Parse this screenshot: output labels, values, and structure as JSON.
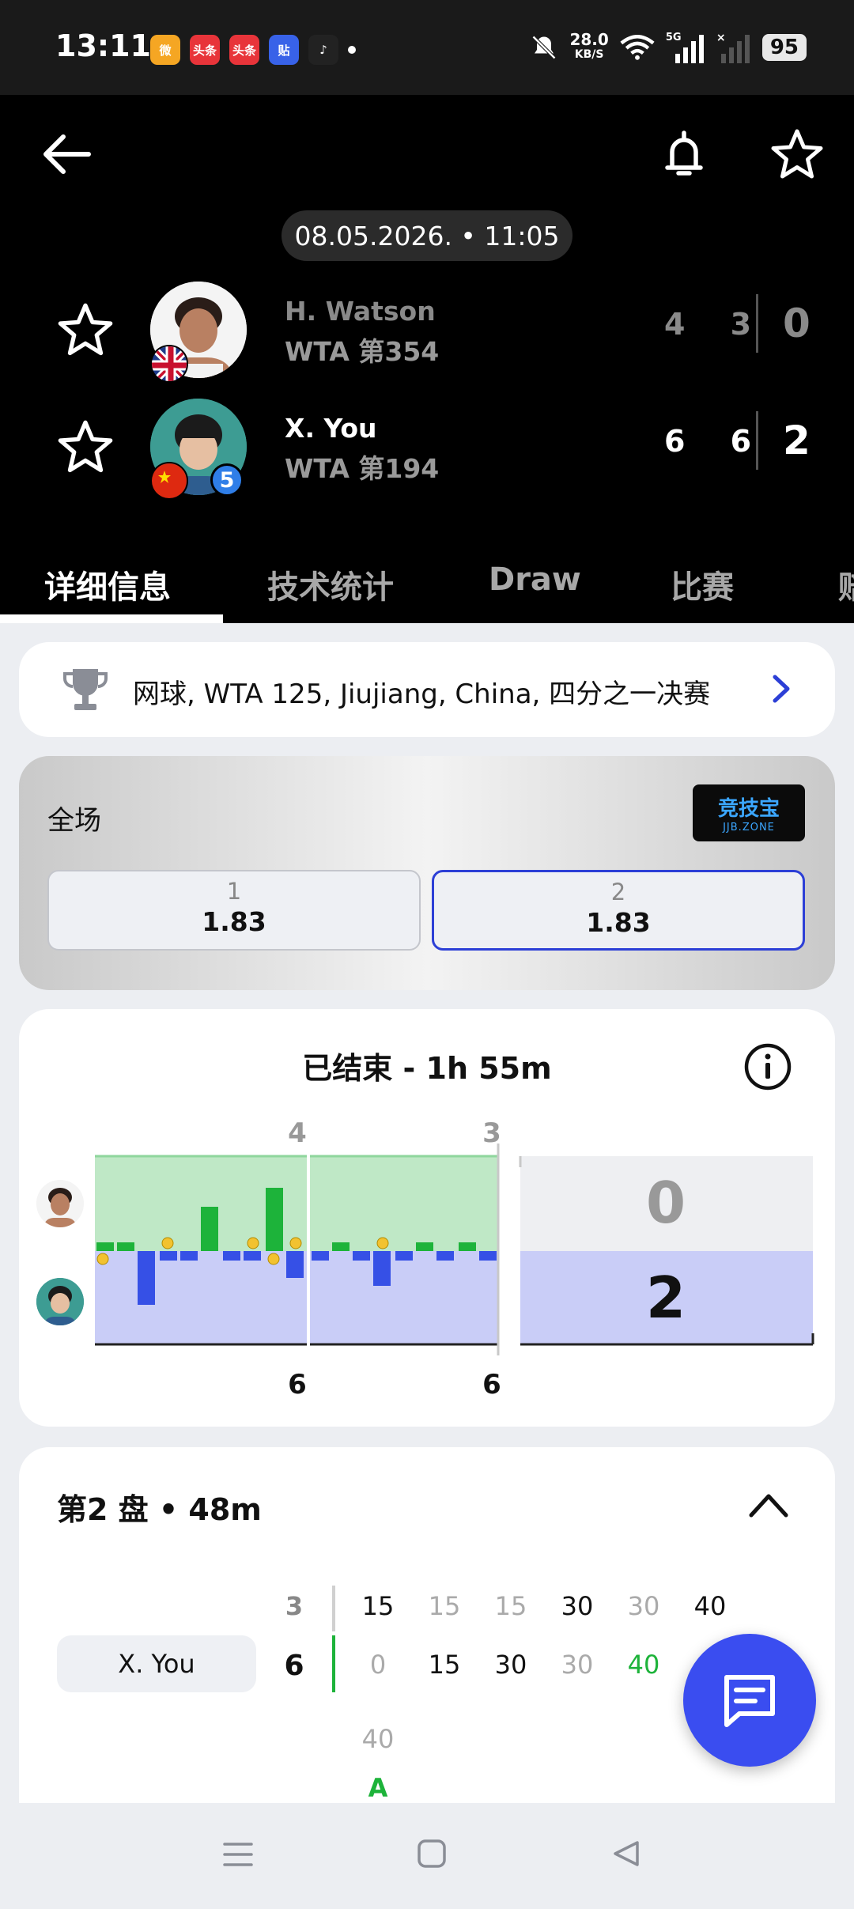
{
  "status_bar": {
    "time": "13:11",
    "app_icons": [
      {
        "name": "weibo-icon",
        "label": "微",
        "color": "#f5a623"
      },
      {
        "name": "toutiao-icon",
        "label": "头条",
        "color": "#e8343a"
      },
      {
        "name": "toutiao-icon-2",
        "label": "头条",
        "color": "#e8343a"
      },
      {
        "name": "tieba-icon",
        "label": "贴",
        "color": "#3862e8"
      },
      {
        "name": "douyin-icon",
        "label": "♪",
        "color": "#222"
      }
    ],
    "net_speed": "28.0",
    "net_unit": "KB/S",
    "signal": "5G",
    "battery": "95"
  },
  "header": {
    "datetime": "08.05.2026. • 11:05",
    "players": [
      {
        "name": "H. Watson",
        "rank": "WTA 第354",
        "sets": "4 3",
        "total": "0",
        "winner": false
      },
      {
        "name": "X. You",
        "rank": "WTA 第194",
        "sets": "6 6",
        "total": "2",
        "winner": true,
        "seed": "5"
      }
    ]
  },
  "tabs": [
    "详细信息",
    "技术统计",
    "Draw",
    "比赛",
    "赔"
  ],
  "breadcrumb": "网球, WTA 125, Jiujiang, China, 四分之一决赛",
  "odds": {
    "title": "全场",
    "bookmaker": "竞技宝",
    "bookmaker_sub": "JJB.ZONE",
    "options": [
      {
        "label": "1",
        "value": "1.83",
        "selected": false
      },
      {
        "label": "2",
        "value": "1.83",
        "selected": true
      }
    ]
  },
  "summary": {
    "title": "已结束 - 1h 55m",
    "top_set_scores": [
      "4",
      "3"
    ],
    "bottom_set_scores": [
      "6",
      "6"
    ],
    "total_top": "0",
    "total_bottom": "2"
  },
  "set_detail": {
    "title": "第2 盘 • 48m",
    "top_games": "3",
    "bottom_games": "6",
    "player_label": "X. You",
    "top_points": [
      "15",
      "15",
      "15",
      "30",
      "30",
      "40"
    ],
    "bottom_points": [
      "0",
      "15",
      "30",
      "30",
      "40",
      ""
    ],
    "extra_top": "40",
    "extra_bottom": "A"
  },
  "colors": {
    "accent": "#3a4df0",
    "win_green": "#1db33a",
    "blue_bar": "#3650e6",
    "green_area": "#bfe8c6",
    "blue_area": "#c9cdf7"
  }
}
